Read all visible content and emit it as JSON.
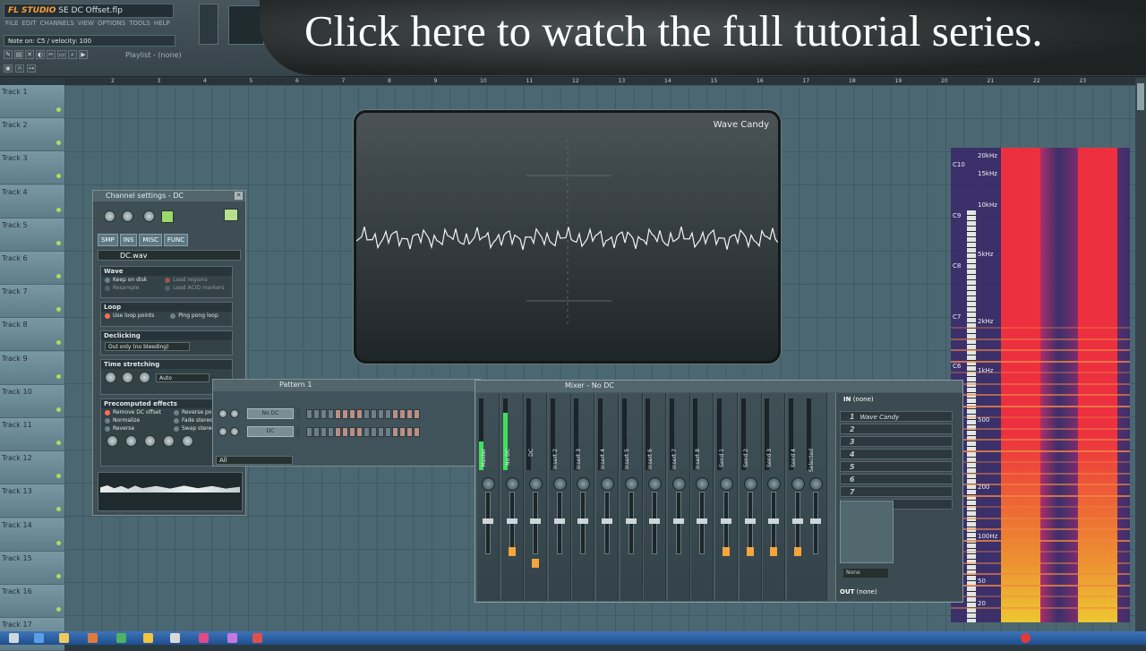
{
  "app": {
    "name": "FL STUDIO",
    "file_title": "SE DC Offset.flp",
    "hint": "Note on: C5 / velocity: 100",
    "menu": [
      "FILE",
      "EDIT",
      "CHANNELS",
      "VIEW",
      "OPTIONS",
      "TOOLS",
      "HELP"
    ],
    "playlist_title": "Playlist - (none)"
  },
  "banner": {
    "text": "Click here to watch the full tutorial series."
  },
  "ruler": [
    "2",
    "3",
    "4",
    "5",
    "6",
    "7",
    "8",
    "9",
    "10",
    "11",
    "12",
    "13",
    "14",
    "15",
    "16",
    "17",
    "18",
    "19",
    "20",
    "21",
    "22",
    "23"
  ],
  "tracks": [
    "Track 1",
    "Track 2",
    "Track 3",
    "Track 4",
    "Track 5",
    "Track 6",
    "Track 7",
    "Track 8",
    "Track 9",
    "Track 10",
    "Track 11",
    "Track 12",
    "Track 13",
    "Track 14",
    "Track 15",
    "Track 16",
    "Track 17"
  ],
  "wave_candy": {
    "title": "Wave Candy"
  },
  "channel_settings": {
    "title": "Channel settings - DC",
    "tabs": [
      "SMP",
      "INS",
      "MISC",
      "FUNC"
    ],
    "sample_file": "DC.wav",
    "wave": {
      "header": "Wave",
      "keep_on_disk": "Keep on disk",
      "resample": "Resample",
      "load_regions": "Load regions",
      "load_acid_markers": "Load ACID markers"
    },
    "loop": {
      "header": "Loop",
      "use_loop_points": "Use loop points",
      "ping_pong": "Ping pong loop"
    },
    "declicking": {
      "header": "Declicking",
      "mode": "Out only (no bleeding)"
    },
    "time_stretching": {
      "header": "Time stretching",
      "mode": "Auto"
    },
    "precomputed": {
      "header": "Precomputed effects",
      "remove_dc": "Remove DC offset",
      "normalize": "Normalize",
      "reverse": "Reverse",
      "reverse_polarity": "Reverse polarity",
      "fade_stereo": "Fade stereo",
      "swap_stereo": "Swap stereo"
    }
  },
  "pattern": {
    "title": "Pattern 1",
    "channels": [
      "No DC",
      "DC"
    ],
    "filter": "All"
  },
  "mixer": {
    "title": "Mixer - No DC",
    "strips": [
      "Master",
      "No DC",
      "DC",
      "Insert 2",
      "Insert 3",
      "Insert 4",
      "Insert 5",
      "Insert 6",
      "Insert 7",
      "Insert 8",
      "Send 1",
      "Send 2",
      "Send 3",
      "Send 4",
      "Selected"
    ],
    "input": "(none)",
    "output": "(none)",
    "slots": [
      {
        "n": "1",
        "name": "Wave Candy"
      },
      {
        "n": "2",
        "name": ""
      },
      {
        "n": "3",
        "name": ""
      },
      {
        "n": "4",
        "name": ""
      },
      {
        "n": "5",
        "name": ""
      },
      {
        "n": "6",
        "name": ""
      },
      {
        "n": "7",
        "name": ""
      },
      {
        "n": "8",
        "name": ""
      }
    ],
    "in_label": "IN",
    "out_label": "OUT",
    "eq_preset": "None"
  },
  "spectrum": {
    "freq_labels": [
      "20kHz",
      "15kHz",
      "10kHz",
      "5kHz",
      "2kHz",
      "1kHz",
      "500",
      "200",
      "100Hz",
      "50",
      "20"
    ],
    "note_labels": [
      "C10",
      "C9",
      "C8",
      "C7",
      "C6"
    ]
  },
  "colors": {
    "accent": "#ff9d3b",
    "grid": "#4b6872",
    "spectrum_hot": "#ff2b3a"
  }
}
